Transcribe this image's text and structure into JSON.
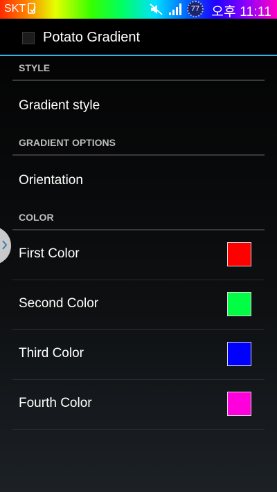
{
  "status_bar": {
    "carrier": "SKT",
    "battery": "77",
    "time": "오후 11:11"
  },
  "action_bar": {
    "title": "Potato Gradient"
  },
  "sections": {
    "style": {
      "header": "STYLE",
      "items": {
        "gradient_style": "Gradient style"
      }
    },
    "gradient_options": {
      "header": "GRADIENT OPTIONS",
      "items": {
        "orientation": "Orientation"
      }
    },
    "color": {
      "header": "COLOR",
      "items": [
        {
          "label": "First Color",
          "color": "#ff0000"
        },
        {
          "label": "Second Color",
          "color": "#00ff44"
        },
        {
          "label": "Third Color",
          "color": "#0000ff"
        },
        {
          "label": "Fourth Color",
          "color": "#ff00dd"
        }
      ]
    }
  },
  "colors": {
    "accent": "#33b5e5",
    "section_header_text": "#bdbdbd",
    "divider": "#3a3a3a"
  },
  "icons": {
    "sms": "sms-notification-icon",
    "mute": "mute-icon",
    "signal": "signal-icon",
    "app": "app-icon",
    "drawer": "chevron-right-icon"
  }
}
